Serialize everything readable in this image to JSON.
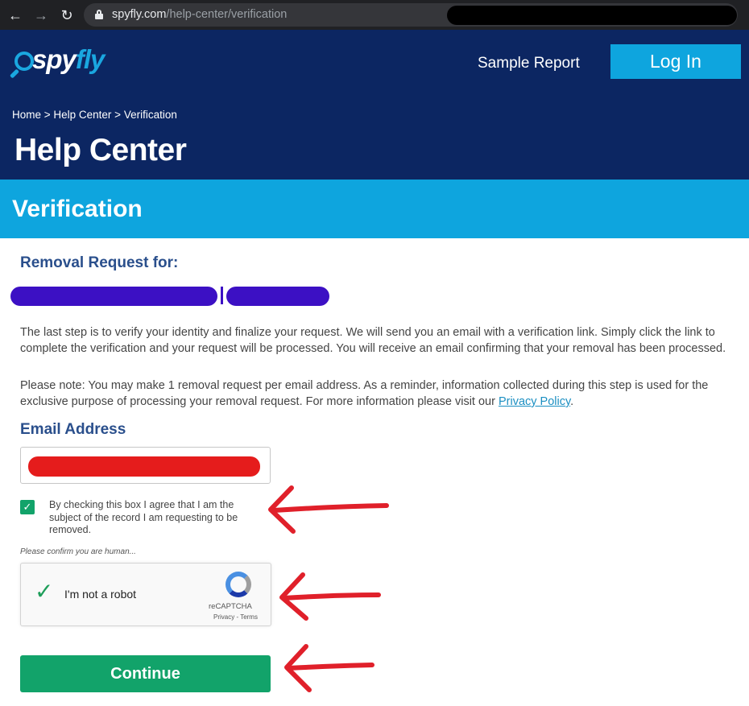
{
  "browser": {
    "url_domain": "spyfly.com",
    "url_path": "/help-center/verification",
    "icons": [
      "back-icon",
      "forward-icon",
      "reload-icon",
      "lock-icon"
    ]
  },
  "header": {
    "logo": {
      "part1": "spy",
      "part2": "fly"
    },
    "sample_report": "Sample Report",
    "login": "Log In",
    "breadcrumb": "Home > Help Center > Verification",
    "title": "Help Center"
  },
  "banner": {
    "title": "Verification"
  },
  "content": {
    "removal_label": "Removal Request for:",
    "para1": "The last step is to verify your identity and finalize your request. We will send you an email with a verification link. Simply click the link to complete the verification and your request will be processed. You will receive an email confirming that your removal has been processed.",
    "para2_prefix": "Please note: You may make 1 removal request per email address. As a reminder, information collected during this step is used for the exclusive purpose of processing your removal request. For more information please visit our ",
    "privacy_link": "Privacy Policy",
    "para2_suffix": ".",
    "email_label": "Email Address",
    "agree_text": "By checking this box I agree that I am the subject of the record I am requesting to be removed.",
    "agree_checked": true,
    "human_note": "Please confirm you are human...",
    "recaptcha": {
      "label": "I'm not a robot",
      "brand": "reCAPTCHA",
      "terms": "Privacy - Terms",
      "checked": true
    },
    "continue": "Continue"
  },
  "colors": {
    "header_navy": "#0c2662",
    "accent_blue": "#0ea5de",
    "heading_blue": "#2a4f8c",
    "button_green": "#12a36a",
    "annotation_red": "#e0202a"
  }
}
